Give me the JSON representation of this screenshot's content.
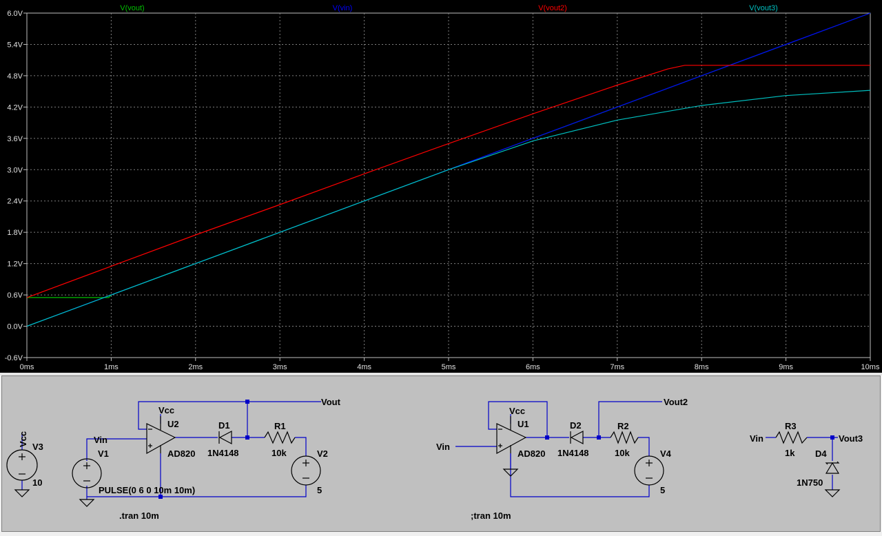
{
  "waveform": {
    "colors": {
      "vout": "#00c000",
      "vin": "#0000ff",
      "vout2": "#ff0000",
      "vout3": "#00c0c0",
      "grid": "#808080",
      "axis": "#c0c0c0"
    }
  },
  "chart_data": {
    "type": "line",
    "xlabel": "",
    "ylabel": "",
    "xlim": [
      0,
      10
    ],
    "ylim": [
      -0.6,
      6.0
    ],
    "x_ticks": [
      "0ms",
      "1ms",
      "2ms",
      "3ms",
      "4ms",
      "5ms",
      "6ms",
      "7ms",
      "8ms",
      "9ms",
      "10ms"
    ],
    "y_ticks": [
      "-0.6V",
      "0.0V",
      "0.6V",
      "1.2V",
      "1.8V",
      "2.4V",
      "3.0V",
      "3.6V",
      "4.2V",
      "4.8V",
      "5.4V",
      "6.0V"
    ],
    "y_tick_values": [
      -0.6,
      0.0,
      0.6,
      1.2,
      1.8,
      2.4,
      3.0,
      3.6,
      4.2,
      4.8,
      5.4,
      6.0
    ],
    "grid": true,
    "legend": "top",
    "series": [
      {
        "name": "V(vout)",
        "color": "#00c000",
        "points": [
          [
            0,
            0.55
          ],
          [
            0.97,
            0.55
          ],
          [
            1,
            0.6
          ],
          [
            2,
            1.2
          ],
          [
            3,
            1.8
          ],
          [
            4,
            2.4
          ],
          [
            5,
            3.0
          ],
          [
            6,
            3.6
          ],
          [
            7,
            4.2
          ],
          [
            8,
            4.8
          ],
          [
            9,
            5.4
          ],
          [
            10,
            6.0
          ]
        ]
      },
      {
        "name": "V(vin)",
        "color": "#0000ff",
        "points": [
          [
            0,
            0.0
          ],
          [
            10,
            6.0
          ]
        ]
      },
      {
        "name": "V(vout2)",
        "color": "#ff0000",
        "points": [
          [
            0,
            0.55
          ],
          [
            1,
            1.15
          ],
          [
            2,
            1.75
          ],
          [
            3,
            2.33
          ],
          [
            4,
            2.92
          ],
          [
            5,
            3.5
          ],
          [
            6,
            4.07
          ],
          [
            7,
            4.62
          ],
          [
            7.6,
            4.93
          ],
          [
            7.8,
            5.0
          ],
          [
            10,
            5.0
          ]
        ]
      },
      {
        "name": "V(vout3)",
        "color": "#00c0c0",
        "points": [
          [
            0,
            0.0
          ],
          [
            1,
            0.6
          ],
          [
            2,
            1.2
          ],
          [
            3,
            1.8
          ],
          [
            4,
            2.4
          ],
          [
            5,
            3.0
          ],
          [
            6,
            3.55
          ],
          [
            7,
            3.95
          ],
          [
            8,
            4.23
          ],
          [
            9,
            4.42
          ],
          [
            10,
            4.52
          ]
        ]
      }
    ]
  },
  "schematic": {
    "vcc_source": {
      "net": "Vcc",
      "name": "V3",
      "value": "10"
    },
    "circuit1": {
      "vin_label": "Vin",
      "vcc_label": "Vcc",
      "source_name": "V1",
      "source_value": "PULSE(0 6 0 10m 10m)",
      "opamp_name": "U2",
      "opamp_model": "AD820",
      "diode_name": "D1",
      "diode_model": "1N4148",
      "resistor_name": "R1",
      "resistor_value": "10k",
      "bias_name": "V2",
      "bias_value": "5",
      "output_label": "Vout"
    },
    "circuit2": {
      "vin_label": "Vin",
      "vcc_label": "Vcc",
      "opamp_name": "U1",
      "opamp_model": "AD820",
      "diode_name": "D2",
      "diode_model": "1N4148",
      "resistor_name": "R2",
      "resistor_value": "10k",
      "bias_name": "V4",
      "bias_value": "5",
      "output_label": "Vout2"
    },
    "circuit3": {
      "vin_label": "Vin",
      "resistor_name": "R3",
      "resistor_value": "1k",
      "zener_name": "D4",
      "zener_model": "1N750",
      "output_label": "Vout3"
    },
    "directives": {
      "tran_active": ".tran 10m",
      "tran_commented": ";tran 10m"
    }
  }
}
